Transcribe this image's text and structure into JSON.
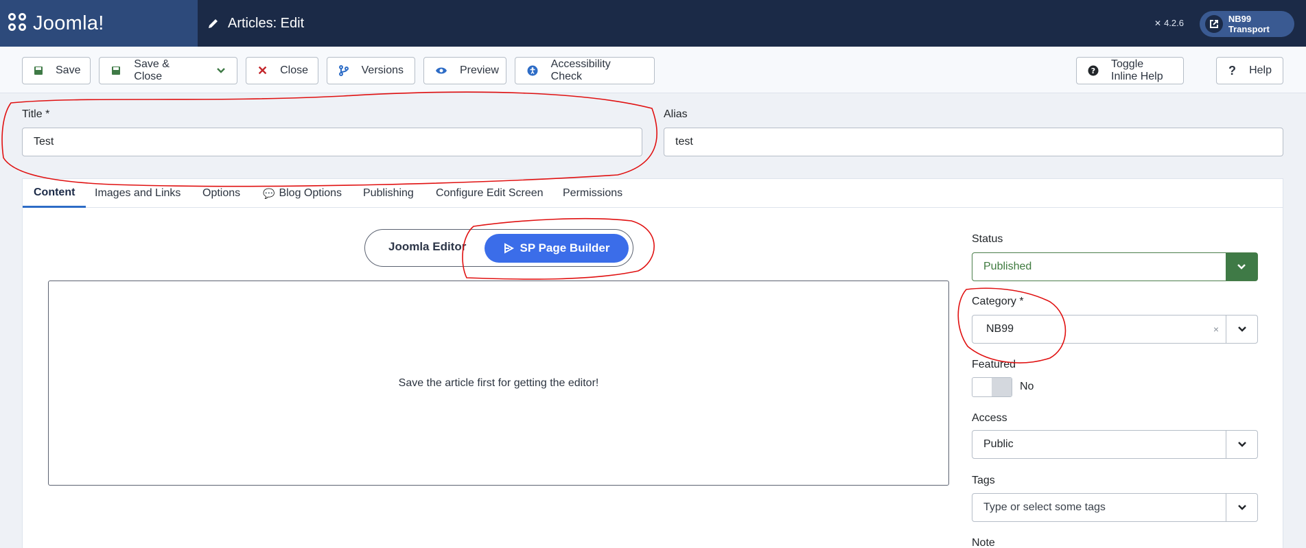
{
  "header": {
    "brand": "Joomla!",
    "page_title": "Articles: Edit",
    "version": "4.2.6",
    "site_button": "NB99 Transport"
  },
  "toolbar": {
    "save": "Save",
    "save_close": "Save & Close",
    "close": "Close",
    "versions": "Versions",
    "preview": "Preview",
    "accessibility": "Accessibility Check",
    "toggle_help": "Toggle Inline Help",
    "help": "Help"
  },
  "form": {
    "title_label": "Title *",
    "title_value": "Test",
    "alias_label": "Alias",
    "alias_value": "test"
  },
  "tabs": [
    {
      "label": "Content",
      "active": true
    },
    {
      "label": "Images and Links"
    },
    {
      "label": "Options"
    },
    {
      "label": "Blog Options"
    },
    {
      "label": "Publishing"
    },
    {
      "label": "Configure Edit Screen"
    },
    {
      "label": "Permissions"
    }
  ],
  "editor_switch": {
    "joomla_editor": "Joomla Editor",
    "sp_page_builder": "SP Page Builder"
  },
  "editor_message": "Save the article first for getting the editor!",
  "sidebar": {
    "status_label": "Status",
    "status_value": "Published",
    "category_label": "Category *",
    "category_value": "NB99",
    "category_clear": "×",
    "featured_label": "Featured",
    "featured_value": "No",
    "access_label": "Access",
    "access_value": "Public",
    "tags_label": "Tags",
    "tags_placeholder": "Type or select some tags",
    "note_label": "Note"
  },
  "colors": {
    "header_bg": "#1b2a47",
    "brand_bg": "#2d4a7b",
    "accent": "#3b6de9",
    "status_green": "#3f7a46",
    "annotation_red": "#e01010"
  }
}
